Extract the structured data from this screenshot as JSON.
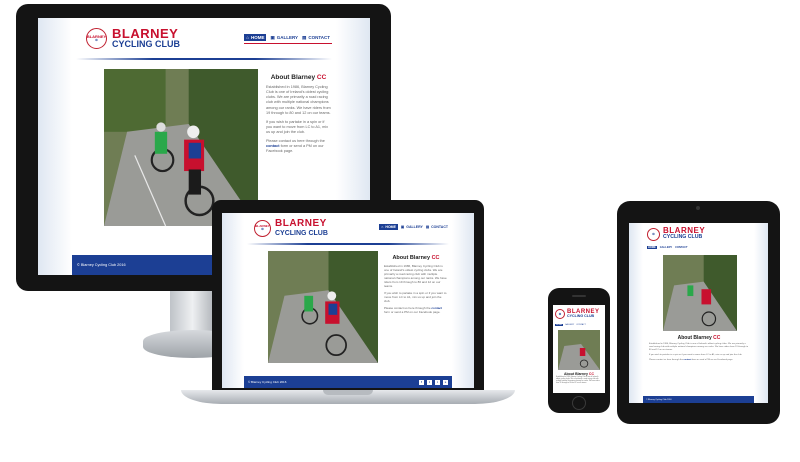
{
  "site": {
    "badge_top": "BLARNEY",
    "badge_bottom": "CYCLING CLUB",
    "title_line1": "BLARNEY",
    "title_line2": "CYCLING CLUB",
    "nav": [
      {
        "label": "HOME",
        "icon": "home-icon",
        "active": true
      },
      {
        "label": "GALLERY",
        "icon": "picture-icon",
        "active": false
      },
      {
        "label": "CONTACT",
        "icon": "contact-card-icon",
        "active": false
      }
    ],
    "about_heading": "About Blarney ",
    "about_heading_accent": "CC",
    "para1": "Established in 1986, Blarney Cycling Club is one of Ireland's oldest cycling clubs. We are primarily a road racing club with multiple national champions among our ranks. We have riders from 19 through to 80 and 12 on our teams.",
    "para2": "If you wish to partake in a spin or if you want to move from LC to A1, mix us up and join the club.",
    "para3_pre": "Please contact us here through the ",
    "para3_link": "contact",
    "para3_post": " form or send a PM on our Facebook page.",
    "footer_text": "© Blarney Cycling Club 2016",
    "social": [
      "facebook-icon",
      "twitter-icon",
      "instagram-icon",
      "strava-icon"
    ]
  },
  "colors": {
    "brand_red": "#c8102e",
    "brand_blue": "#1c3f94",
    "device_black": "#141414"
  }
}
